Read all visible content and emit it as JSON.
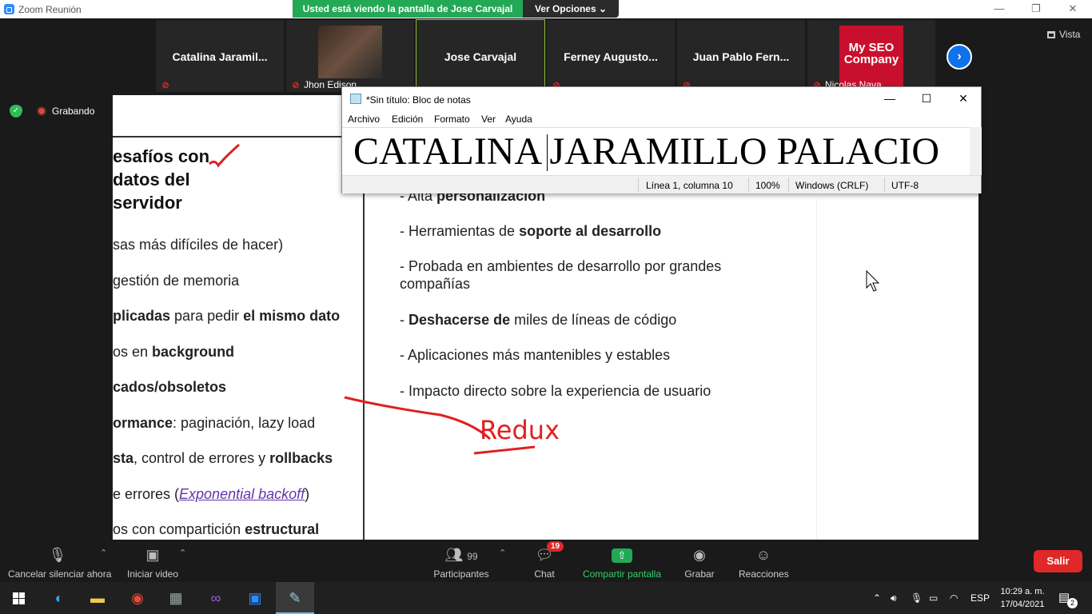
{
  "window": {
    "title": "Zoom Reunión",
    "minimize": "—",
    "restore": "❐",
    "close": "✕"
  },
  "banner": {
    "viewing": "Usted está viendo la pantalla de Jose Carvajal",
    "options": "Ver Opciones"
  },
  "participants_strip": {
    "tiles": [
      {
        "name": "Catalina  Jaramil...",
        "sub": ""
      },
      {
        "name": "",
        "sub": "Jhon Edison"
      },
      {
        "name": "Jose Carvajal",
        "sub": ""
      },
      {
        "name": "Ferney  Augusto...",
        "sub": ""
      },
      {
        "name": "Juan  Pablo  Fern...",
        "sub": ""
      },
      {
        "name": "",
        "sub": "Nicolas Nava"
      }
    ],
    "seo_logo_line1": "My SEO",
    "seo_logo_line2": "Company",
    "view_label": "Vista"
  },
  "recording": {
    "label": "Grabando"
  },
  "slide": {
    "heading": [
      "esafíos con",
      "datos del",
      "servidor"
    ],
    "left_items": [
      {
        "pre": "sas más difíciles de hacer)",
        "b": "",
        "post": ""
      },
      {
        "pre": "gestión de memoria",
        "b": "",
        "post": ""
      },
      {
        "pre": "",
        "b": "plicadas",
        "post": " para pedir ",
        "b2": "el mismo dato"
      },
      {
        "pre": "os en ",
        "b": "background",
        "post": ""
      },
      {
        "pre": "",
        "b": "cados/obsoletos",
        "post": ""
      },
      {
        "pre": "",
        "b": "ormance",
        "post": ": paginación, lazy load"
      },
      {
        "pre": "",
        "b": "sta",
        "post": ", control de errores y ",
        "b2": "rollbacks"
      },
      {
        "pre": "e errores (",
        "link": "Exponential backoff",
        "post": ")"
      },
      {
        "pre": "os con compartición ",
        "b": "estructural",
        "post": ""
      }
    ],
    "right_items": [
      {
        "pre": "- Alta ",
        "b": "personalización",
        "post": ""
      },
      {
        "pre": "- Herramientas de ",
        "b": "soporte al desarrollo",
        "post": ""
      },
      {
        "pre": "- Probada en ambientes de desarrollo por grandes",
        "b": "",
        "post": ""
      },
      {
        "pre": "compañías",
        "b": "",
        "post": ""
      },
      {
        "pre": "- ",
        "b": "Deshacerse de",
        "post": " miles de líneas de código"
      },
      {
        "pre": "- Aplicaciones más mantenibles y estables",
        "b": "",
        "post": ""
      },
      {
        "pre": "- Impacto directo sobre la experiencia de usuario",
        "b": "",
        "post": ""
      }
    ],
    "annotation": "Redux"
  },
  "notepad": {
    "title": "*Sin título: Bloc de notas",
    "menu": [
      "Archivo",
      "Edición",
      "Formato",
      "Ver",
      "Ayuda"
    ],
    "content": "CATALINA JARAMILLO PALACIO",
    "status": {
      "position": "Línea 1, columna 10",
      "zoom": "100%",
      "eol": "Windows (CRLF)",
      "encoding": "UTF-8"
    }
  },
  "toolbar": {
    "mute": "Cancelar silenciar ahora",
    "video": "Iniciar video",
    "participants": "Participantes",
    "participants_count": "99",
    "chat": "Chat",
    "chat_badge": "19",
    "share": "Compartir pantalla",
    "record": "Grabar",
    "reactions": "Reacciones",
    "leave": "Salir"
  },
  "taskbar": {
    "lang": "ESP",
    "time": "10:29 a. m.",
    "date": "17/04/2021",
    "notifications": "2"
  },
  "colors": {
    "zoom_blue": "#0e72ed",
    "share_green": "#23a855",
    "leave_red": "#e02828",
    "ink_red": "#e02020"
  }
}
